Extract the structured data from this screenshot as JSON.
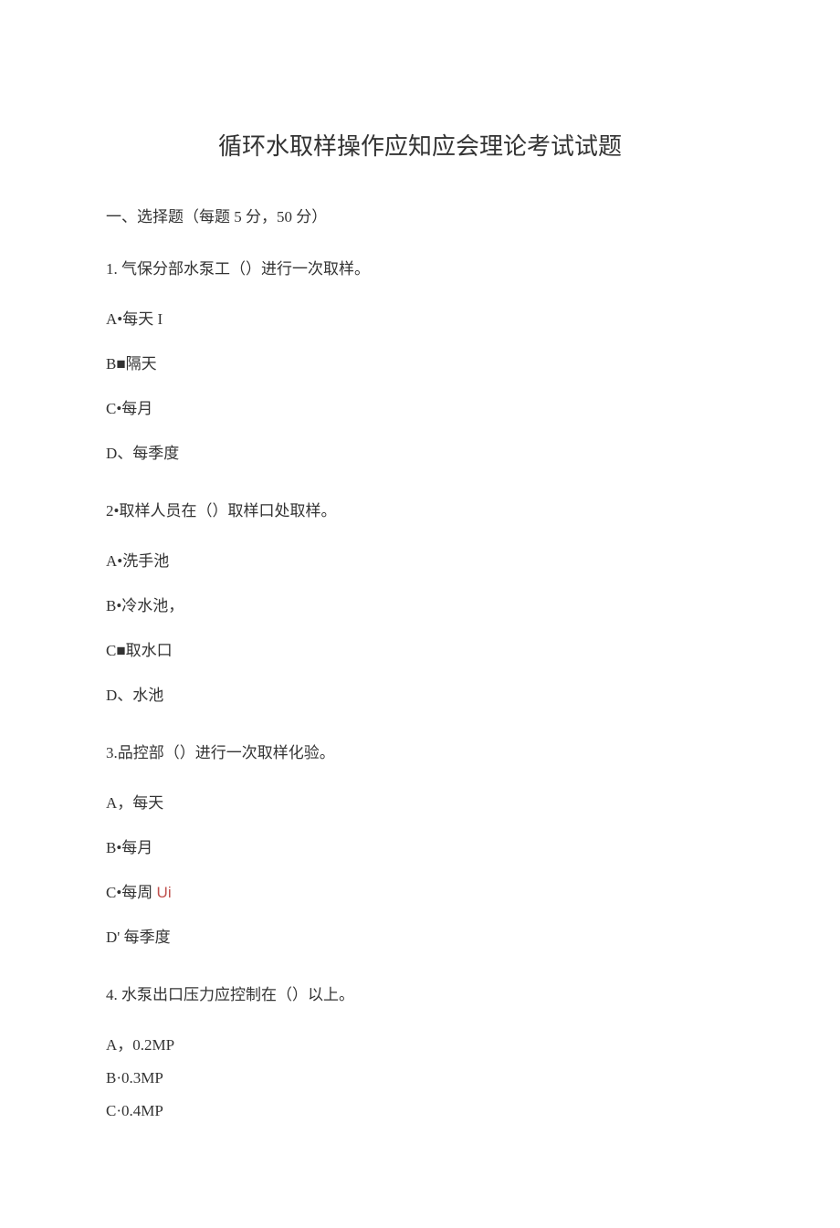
{
  "title": "循环水取样操作应知应会理论考试试题",
  "section_header": "一、选择题（每题 5 分，50 分）",
  "q1": {
    "stem": "1. 气保分部水泵工（）进行一次取样。",
    "a": "A•每天 I",
    "b": "B■隔天",
    "c": "C•每月",
    "d": "D、每季度"
  },
  "q2": {
    "stem": "2•取样人员在（）取样口处取样。",
    "a": "A•洗手池",
    "b": "B•冷水池，",
    "c": "C■取水口",
    "d": "D、水池"
  },
  "q3": {
    "stem": "3.品控部（）进行一次取样化验。",
    "a": "A，每天",
    "b": "B•每月",
    "c_pre": "C•每周 ",
    "c_accent": "Ui",
    "d": "D' 每季度"
  },
  "q4": {
    "stem": "4. 水泵出口压力应控制在（）以上。",
    "a": "A，0.2MP",
    "b": "B·0.3MP",
    "c": "C·0.4MP"
  }
}
